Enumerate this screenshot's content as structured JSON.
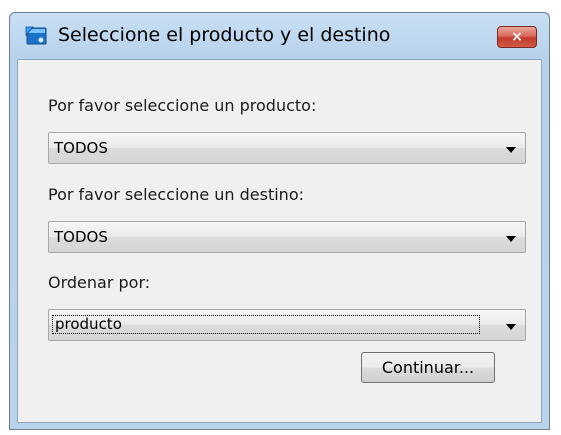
{
  "window": {
    "title": "Seleccione el producto y el destino",
    "close_glyph": "×",
    "icon": "app-icon"
  },
  "form": {
    "product_label": "Por favor seleccione un producto:",
    "product_value": "TODOS",
    "destination_label": "Por favor seleccione un destino:",
    "destination_value": "TODOS",
    "sort_label": "Ordenar por:",
    "sort_value": "producto",
    "continue_label": "Continuar..."
  },
  "colors": {
    "title_bar": "#b9d3ec",
    "close_button": "#c23b2c",
    "client_background": "#f0f0f0"
  }
}
